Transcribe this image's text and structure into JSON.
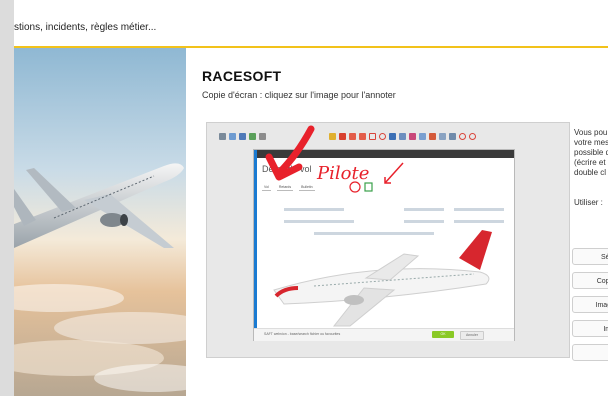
{
  "header": {
    "text": "stions, incidents, règles métier..."
  },
  "app": {
    "title": "RACESOFT",
    "subtitle": "Copie d'écran : cliquez sur l'image pour l'annoter"
  },
  "screenshot": {
    "inner_title": "Détail du vol",
    "tabs": [
      "Vol",
      "Retards",
      "Bulletin"
    ],
    "annotation": "Pilote",
    "footer_text": "SAFT webvion - base/search fichier ou favourites",
    "ok_label": "OK",
    "cancel_label": "Annuler"
  },
  "side": {
    "lines": [
      "Vous pou",
      "votre mes",
      "possible d",
      "(écrire et",
      "double cl"
    ],
    "use_label": "Utiliser :",
    "buttons": [
      "Séle",
      "Copie",
      "Image",
      "Ima",
      ""
    ]
  },
  "colors": {
    "accent_line": "#f2c21a",
    "annotation_red": "#e8212b",
    "ok_green": "#8ac926"
  }
}
